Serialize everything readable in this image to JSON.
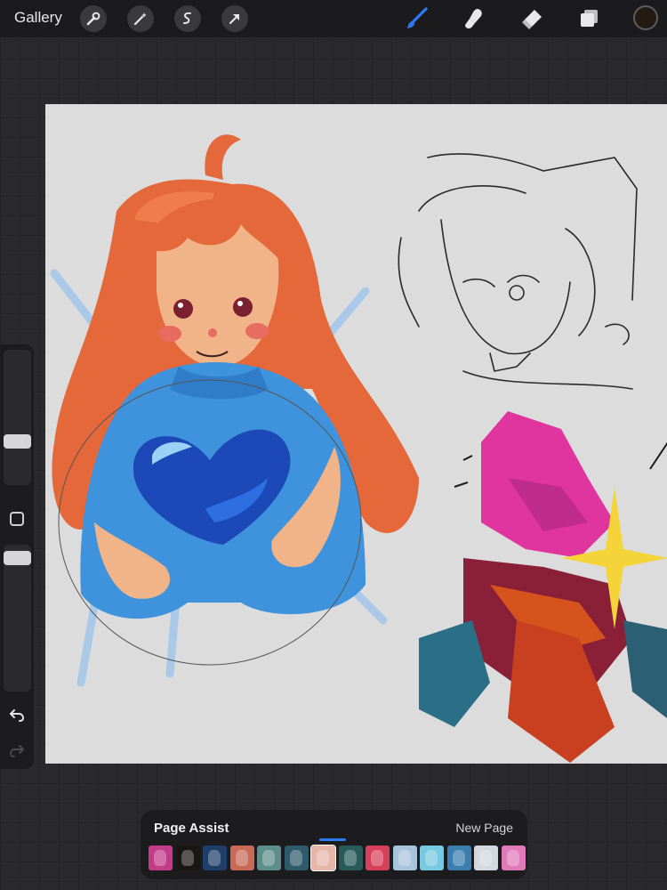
{
  "topbar": {
    "gallery_label": "Gallery",
    "left_tools": [
      "wrench-icon",
      "magic-wand-icon",
      "selection-icon",
      "transform-arrow-icon"
    ],
    "right_tools": [
      "brush-icon",
      "smudge-icon",
      "eraser-icon",
      "layers-icon"
    ],
    "active_tool": "brush-icon",
    "accent_color": "#2c7bf5",
    "current_color": "#241a14"
  },
  "page_panel": {
    "title": "Page Assist",
    "new_page_label": "New Page",
    "active_index": 6,
    "thumbnails": [
      {
        "color": "#c23c8a"
      },
      {
        "color": "#1a1614"
      },
      {
        "color": "#1f3e6a"
      },
      {
        "color": "#c86a58"
      },
      {
        "color": "#5d8f8a"
      },
      {
        "color": "#2f5a6b"
      },
      {
        "color": "#e6b7a8"
      },
      {
        "color": "#275a58"
      },
      {
        "color": "#d7405a"
      },
      {
        "color": "#a8c4dc"
      },
      {
        "color": "#76c9e0"
      },
      {
        "color": "#3a7fb0"
      },
      {
        "color": "#d3d7df"
      },
      {
        "color": "#e07ab8"
      }
    ]
  },
  "sidebar": {
    "brush_size_level": 0.3,
    "opacity_level": 0.95,
    "icons": [
      "modify-square-icon",
      "undo-icon",
      "redo-icon"
    ]
  },
  "canvas": {
    "background": "#dcdcdd",
    "sketches": [
      "red-haired-girl-holding-heart",
      "pencil-sketch-portrait",
      "magenta-crystal-sparkle"
    ]
  }
}
